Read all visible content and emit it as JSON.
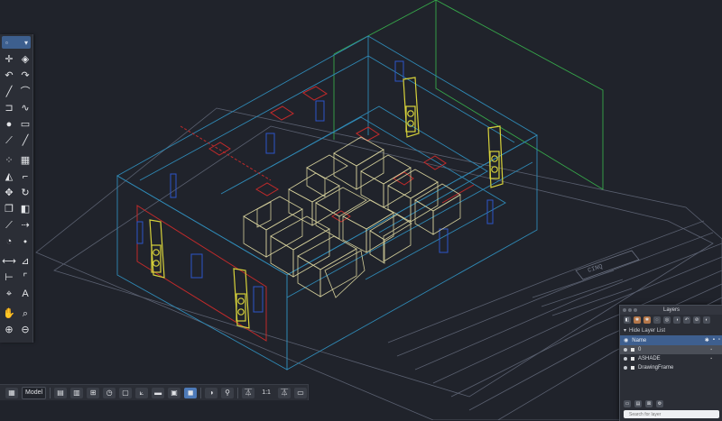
{
  "viewport": {
    "background": "#20232b",
    "layer_colors": {
      "cyan": "#2f89b5",
      "green": "#36a84a",
      "red": "#c02a2a",
      "yellow": "#d7d23a",
      "blue": "#2d55c8",
      "cream": "#e6e0a6",
      "grey": "#5a6070"
    },
    "title_block_text": "CINQ"
  },
  "tool_palette": {
    "tools": [
      "move-crosshair-icon",
      "color-wheel-icon",
      "undo-icon",
      "redo-icon",
      "line-icon",
      "arc-icon",
      "polyline-icon",
      "spline-icon",
      "circle-icon",
      "rectangle-icon",
      "construction-line-icon",
      "ray-icon",
      "block-icon",
      "grid-array-icon",
      "mirror-icon",
      "fillet-icon",
      "move-icon",
      "rotate-icon",
      "copy-icon",
      "paste-icon",
      "trim-icon",
      "extend-icon",
      "boolean-icon",
      "eraser-icon",
      "dimension-icon",
      "angle-dimension-icon",
      "linear-dimension-icon",
      "leader-icon",
      "measure-icon",
      "text-icon",
      "pan-icon",
      "zoom-icon",
      "zoom-in-icon",
      "zoom-out-icon"
    ]
  },
  "status_bar": {
    "model_label": "Model",
    "scale_label": "1:1"
  },
  "layers_panel": {
    "title": "Layers",
    "hide_label": "Hide Layer List",
    "header_label": "Name",
    "layers": [
      {
        "name": "0",
        "current": true
      },
      {
        "name": "ASHADE",
        "current": false
      },
      {
        "name": "DrawingFrame",
        "current": false
      }
    ],
    "search_placeholder": "Search for layer"
  }
}
